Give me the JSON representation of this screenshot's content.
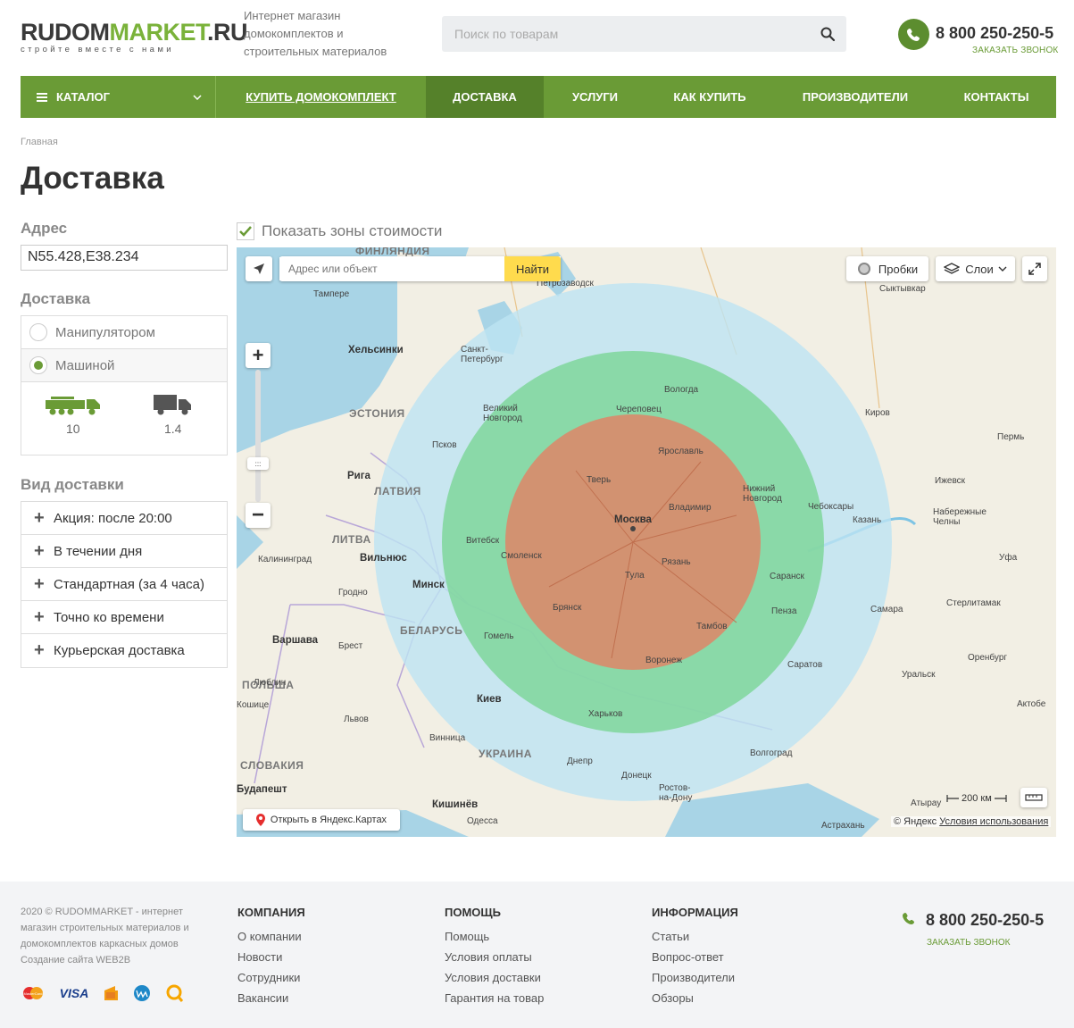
{
  "header": {
    "logo_name_1": "RUDOM",
    "logo_name_2": "MARKET",
    "logo_name_3": ".RU",
    "logo_tagline": "стройте вместе с нами",
    "tagline": "Интернет магазин домокомплектов и строительных материалов",
    "search_placeholder": "Поиск по товарам",
    "phone": "8 800 250-250-5",
    "callback": "ЗАКАЗАТЬ ЗВОНОК"
  },
  "nav": {
    "catalog": "КАТАЛОГ",
    "items": [
      "КУПИТЬ ДОМОКОМПЛЕКТ",
      "ДОСТАВКА",
      "УСЛУГИ",
      "КАК КУПИТЬ",
      "ПРОИЗВОДИТЕЛИ",
      "КОНТАКТЫ"
    ],
    "active": "ДОСТАВКА"
  },
  "breadcrumb": "Главная",
  "page_title": "Доставка",
  "address": {
    "label": "Адрес",
    "value": "N55.428,E38.234"
  },
  "delivery": {
    "label": "Доставка",
    "options": [
      "Манипулятором",
      "Машиной"
    ],
    "selected": "Машиной",
    "trucks": [
      {
        "icon": "truck-large-icon",
        "value": "10"
      },
      {
        "icon": "truck-small-icon",
        "value": "1.4"
      }
    ]
  },
  "delivery_type": {
    "label": "Вид доставки",
    "items": [
      "Акция: после 20:00",
      "В течении дня",
      "Стандартная (за 4 часа)",
      "Точно ко времени",
      "Курьерская доставка"
    ]
  },
  "zones_checkbox": {
    "label": "Показать зоны стоимости",
    "checked": true
  },
  "map": {
    "search_placeholder": "Адрес или объект",
    "find_button": "Найти",
    "traffic_button": "Пробки",
    "layers_button": "Слои",
    "open_in_yandex": "Открыть в Яндекс.Картах",
    "scale": "200 км",
    "copyright": "© Яндекс",
    "terms": "Условия использования",
    "zone_colors": {
      "outer": "#bde3f2",
      "middle": "#7fd69b",
      "inner": "#d9896a"
    },
    "countries": [
      "ФИНЛЯНДИЯ",
      "ЭСТОНИЯ",
      "ЛАТВИЯ",
      "ЛИТВА",
      "БЕЛАРУСЬ",
      "ПОЛЬША",
      "УКРАИНА",
      "СЛОВАКИЯ"
    ],
    "cities": [
      "Тампере",
      "Петрозаводск",
      "Сыктывкар",
      "Хельсинки",
      "Санкт-Петербург",
      "Вологда",
      "Великий Новгород",
      "Череповец",
      "Киров",
      "Пермь",
      "Псков",
      "Ярославль",
      "Тверь",
      "Нижний Новгород",
      "Ижевск",
      "Рига",
      "Владимир",
      "Чебоксары",
      "Набережные Челны",
      "Москва",
      "Казань",
      "Витебск",
      "Смоленск",
      "Калининград",
      "Вильнюс",
      "Рязань",
      "Уфа",
      "Минск",
      "Тула",
      "Саранск",
      "Гродно",
      "Брянск",
      "Пенза",
      "Самара",
      "Стерлитамак",
      "Варшава",
      "Брест",
      "Гомель",
      "Тамбов",
      "Воронеж",
      "Саратов",
      "Оренбург",
      "Уральск",
      "Люблин",
      "Киев",
      "Харьков",
      "Актобе",
      "Кошице",
      "Львов",
      "Винница",
      "Волгоград",
      "Днепр",
      "Донецк",
      "Ростов-на-Дону",
      "Будапешт",
      "Кишинёв",
      "Одесса",
      "Атырау",
      "Астрахань"
    ]
  },
  "footer": {
    "copyright": "2020 © RUDOMMARKET - интернет магазин строительных материалов и домокомплектов каркасных домов",
    "made_by": "Создание сайта WEB2B",
    "columns": [
      {
        "title": "КОМПАНИЯ",
        "links": [
          "О компании",
          "Новости",
          "Сотрудники",
          "Вакансии"
        ]
      },
      {
        "title": "ПОМОЩЬ",
        "links": [
          "Помощь",
          "Условия оплаты",
          "Условия доставки",
          "Гарантия на товар"
        ]
      },
      {
        "title": "ИНФОРМАЦИЯ",
        "links": [
          "Статьи",
          "Вопрос-ответ",
          "Производители",
          "Обзоры"
        ]
      }
    ],
    "phone": "8 800 250-250-5",
    "callback": "ЗАКАЗАТЬ ЗВОНОК",
    "payments": [
      "mastercard-icon",
      "visa-icon",
      "yandex-money-icon",
      "webmoney-icon",
      "qiwi-icon"
    ]
  },
  "colors": {
    "brand_green": "#6a9b36",
    "nav_active": "#55812a",
    "logo_green": "#7ab23a"
  }
}
